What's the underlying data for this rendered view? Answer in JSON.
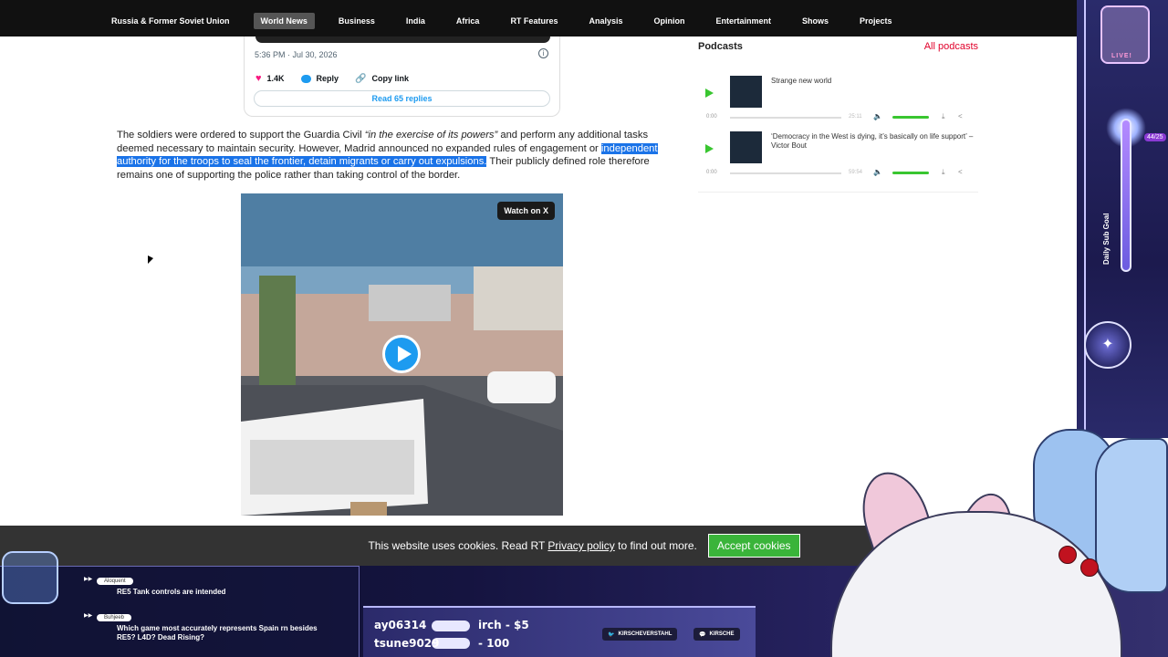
{
  "nav": {
    "items": [
      "Russia & Former Soviet Union",
      "World News",
      "Business",
      "India",
      "Africa",
      "RT Features",
      "Analysis",
      "Opinion",
      "Entertainment",
      "Shows",
      "Projects"
    ],
    "active": "World News"
  },
  "tweet": {
    "time": "5:36 PM · Jul 30, 2026",
    "likes": "1.4K",
    "reply": "Reply",
    "copy_link": "Copy link",
    "read_replies": "Read 65 replies"
  },
  "article": {
    "p1_a": "The soldiers were ordered to support the Guardia Civil ",
    "p1_em": "“in the exercise of its powers”",
    "p1_b": " and perform any additional tasks deemed necessary to maintain security. However, Madrid announced no expanded rules of engagement or ",
    "p1_hl": "independent authority for the troops to seal the frontier, detain migrants or carry out expulsions.",
    "p1_c": " Their publicly defined role therefore remains one of supporting the police rather than taking control of the border."
  },
  "video": {
    "watch_label": "Watch on X"
  },
  "podcasts": {
    "title": "Podcasts",
    "all_label": "All podcasts",
    "items": [
      {
        "name": "Strange new world",
        "start": "0:00",
        "duration": "25:11"
      },
      {
        "name": "‘Democracy in the West is dying, it’s basically on life support’ – Victor Bout",
        "start": "0:00",
        "duration": "59:54"
      }
    ]
  },
  "cookie": {
    "text_a": "This website uses cookies. Read RT ",
    "link": "Privacy policy",
    "text_b": " to find out more.",
    "button": "Accept cookies"
  },
  "stream": {
    "chat": [
      {
        "user": "Aloquent",
        "text": "RE5 Tank controls are intended"
      },
      {
        "user": "Buhjeeb",
        "text": "Which game most accurately represents Spain rn besides RE5? L4D? Dead Rising?"
      }
    ],
    "subs": [
      "ay06314",
      "tsune9029"
    ],
    "donations": [
      "irch - $5",
      "- 100"
    ],
    "social": [
      "KIRSCHEVERSTAHL",
      "KIRSCHE"
    ],
    "live": "LIVE!",
    "goal_label": "Daily Sub Goal",
    "goal_count": "44/25",
    "goal_progress": 1.0
  },
  "colors": {
    "accent_red": "#e0002a",
    "highlight": "#1a73e8",
    "cookie_button": "#3ab43a"
  }
}
